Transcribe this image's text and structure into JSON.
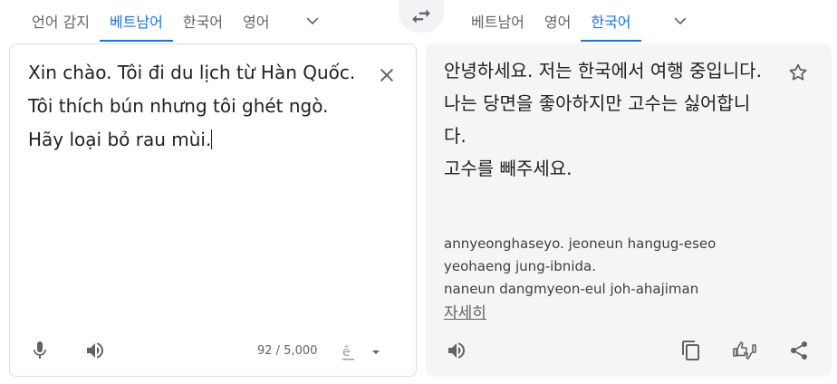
{
  "source_langs": {
    "tabs": [
      {
        "label": "언어 감지",
        "active": false
      },
      {
        "label": "베트남어",
        "active": true
      },
      {
        "label": "한국어",
        "active": false
      },
      {
        "label": "영어",
        "active": false
      }
    ]
  },
  "target_langs": {
    "tabs": [
      {
        "label": "베트남어",
        "active": false
      },
      {
        "label": "영어",
        "active": false
      },
      {
        "label": "한국어",
        "active": true
      }
    ]
  },
  "source": {
    "lines": [
      "Xin chào. Tôi đi du lịch từ Hàn Quốc.",
      "Tôi thích bún nhưng tôi ghét ngò.",
      "Hãy loại bỏ rau mùi."
    ],
    "char_count": "92 / 5,000"
  },
  "target": {
    "lines": [
      "안녕하세요. 저는 한국에서 여행 중입니다.",
      "나는 당면을 좋아하지만 고수는 싫어합니다.",
      "고수를 빼주세요."
    ],
    "romanization": [
      "annyeonghaseyo. jeoneun hangug-eseo",
      "yeohaeng jung-ibnida.",
      "naneun dangmyeon-eul joh-ahajiman"
    ],
    "more_label": "자세히"
  },
  "colors": {
    "accent": "#1a73e8",
    "icon": "#5f6368",
    "target_bg": "#f5f5f5"
  },
  "icons": {
    "swap": "swap-arrows-icon",
    "more_langs": "chevron-down-icon",
    "clear": "close-icon",
    "mic": "mic-icon",
    "listen": "speaker-icon",
    "ime": "keyboard-input-icon",
    "star": "star-icon",
    "copy": "copy-icon",
    "feedback": "thumbs-feedback-icon",
    "share": "share-icon"
  }
}
